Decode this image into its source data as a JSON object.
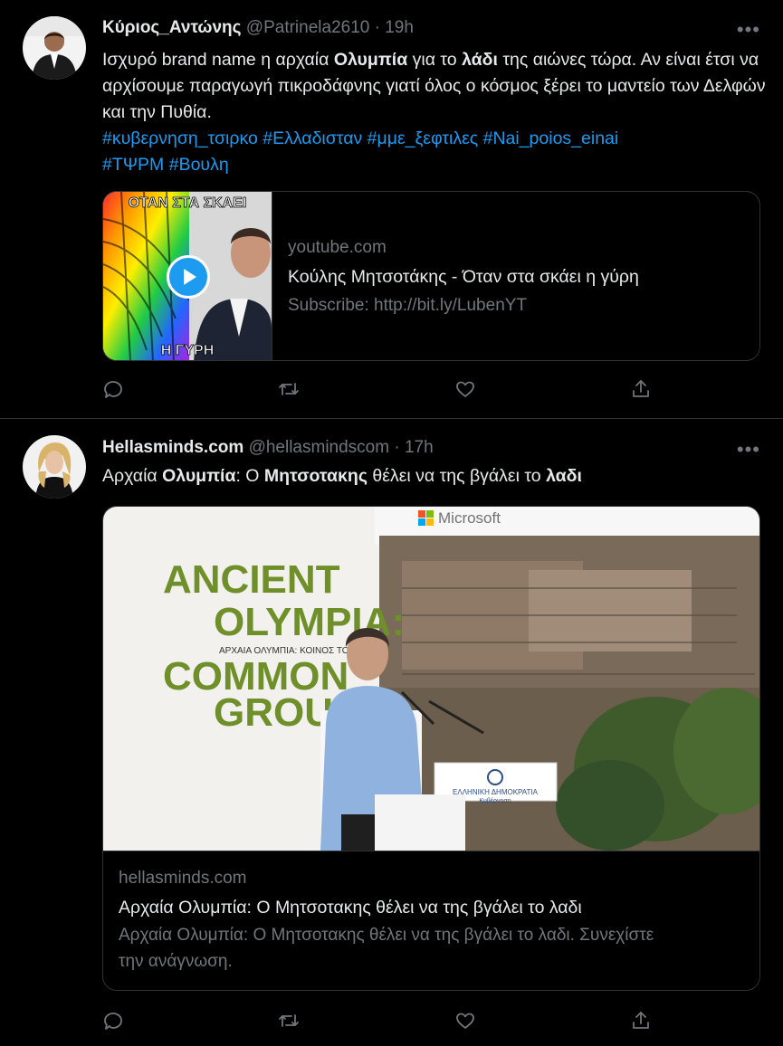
{
  "tweets": [
    {
      "name": "Κύριος_Αντώνης",
      "handle": "@Patrinela2610",
      "sep": "·",
      "time": "19h",
      "more": "•••",
      "text": {
        "p1": "Ισχυρό brand name η αρχαία ",
        "b1": "Ολυμπία",
        "p2": " για το ",
        "b2": "λάδι",
        "p3": " της αιώνες τώρα. Αν είναι έτσι να αρχίσουμε παραγωγή πικροδάφνης γιατί όλος ο κόσμος ξέρει το μαντείο των Δελφών και την Πυθία.",
        "tags_line1": "#κυβερνηση_τσιρκο #Ελλαδισταν #μμε_ξεφτιλες  #Nai_poios_einai",
        "tags_line2": "#ΤΨΡΜ #Βουλη"
      },
      "card": {
        "thumb_top_text": "ΟΤΑΝ ΣΤΑ ΣΚΑΕΙ",
        "thumb_bottom_text": "Η ΓΥΡΗ",
        "domain": "youtube.com",
        "title": "Κούλης Μητσοτάκης - Όταν στα σκάει η γύρη",
        "desc": "Subscribe: http://bit.ly/LubenYT"
      }
    },
    {
      "name": "Hellasminds.com",
      "handle": "@hellasmindscom",
      "sep": "·",
      "time": "17h",
      "more": "•••",
      "text": {
        "b1": "Ολυμπία",
        "p1": "Αρχαία ",
        "p2": ": Ο ",
        "b2": "Μητσοτακης",
        "p3": " θέλει να της βγάλει το ",
        "b3": "λαδι"
      },
      "card": {
        "img_microsoft": "Microsoft",
        "img_line1": "ANCIENT",
        "img_line2": "OLYMPIA:",
        "img_sub": "ΑΡΧΑΙΑ ΟΛΥΜΠΙΑ: ΚΟΙΝΟΣ ΤΟΠΟΣ",
        "img_line3": "COMMON",
        "img_line4": "GROUN",
        "podium_line1": "ΕΛΛΗΝΙΚΗ ΔΗΜΟΚΡΑΤΙΑ",
        "podium_line2": "Κυβέρνηση",
        "domain": "hellasminds.com",
        "title": "Αρχαία Ολυμπία: Ο Μητσοτακης θέλει να της βγάλει το λαδι",
        "desc": "Αρχαία Ολυμπία: Ο Μητσοτακης θέλει να της βγάλει το λαδι. Συνεχίστε την ανάγνωση."
      }
    }
  ],
  "colors": {
    "bg": "#000000",
    "link": "#1d9bf0",
    "muted": "#71767b",
    "text": "#e7e9ea",
    "border": "#2f3336"
  },
  "icons": [
    "reply-icon",
    "retweet-icon",
    "like-icon",
    "share-icon",
    "more-icon",
    "play-icon"
  ]
}
